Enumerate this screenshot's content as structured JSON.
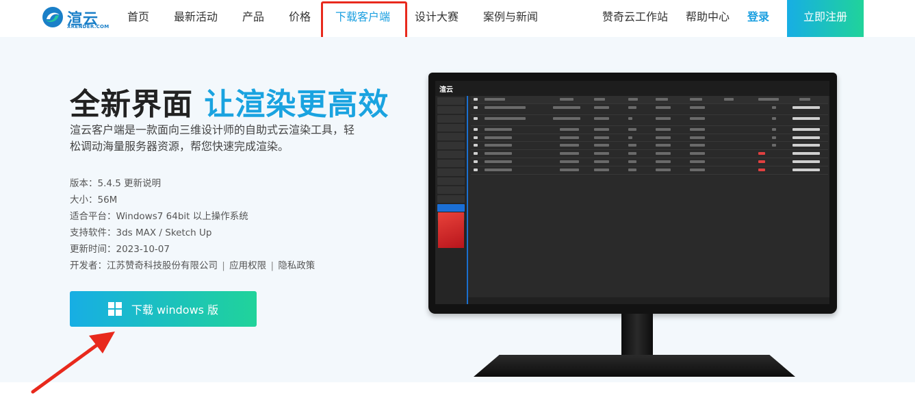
{
  "brand": {
    "name": "渲云",
    "sub": "XRENDER.COM",
    "colors": {
      "primary": "#1a9fe0",
      "gradient_start": "#17aee4",
      "gradient_end": "#20d39a",
      "highlight": "#e8291c"
    }
  },
  "nav": {
    "items": [
      {
        "label": "首页"
      },
      {
        "label": "最新活动"
      },
      {
        "label": "产品"
      },
      {
        "label": "价格"
      },
      {
        "label": "下载客户端",
        "active": true
      },
      {
        "label": "设计大赛"
      },
      {
        "label": "案例与新闻"
      }
    ],
    "right": [
      {
        "label": "赞奇云工作站"
      },
      {
        "label": "帮助中心"
      }
    ],
    "login": "登录",
    "register": "立即注册"
  },
  "hero": {
    "title_main": "全新界面",
    "title_accent": "让渲染更高效",
    "description": "渲云客户端是一款面向三维设计师的自助式云渲染工具，轻松调动海量服务器资源，帮您快速完成渲染。",
    "specs": {
      "version_label": "版本：",
      "version_value": "5.4.5",
      "version_link": "更新说明",
      "size": "大小：56M",
      "platform": "适合平台：Windows7 64bit 以上操作系统",
      "software": "支持软件：3ds MAX / Sketch Up",
      "updated": "更新时间：2023-10-07",
      "developer_label": "开发者：",
      "developer_value": "江苏赞奇科技股份有限公司",
      "permissions": "应用权限",
      "privacy": "隐私政策",
      "separator": "|"
    },
    "download_button": "下载 windows 版",
    "download_icon": "windows-icon"
  },
  "monitor": {
    "screen_logo": "渲云"
  }
}
